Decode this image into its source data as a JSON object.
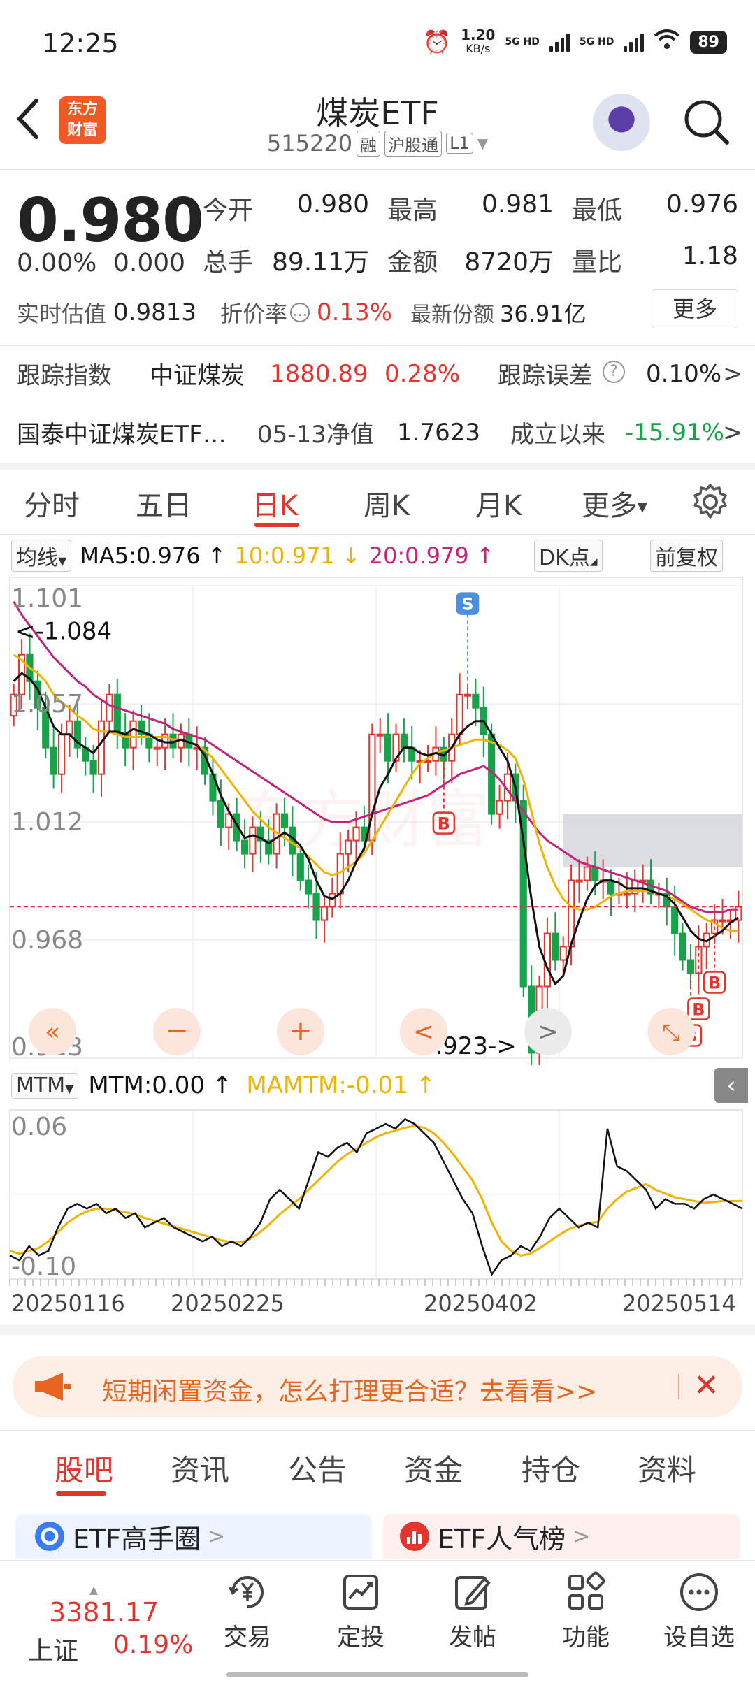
{
  "status": {
    "time": "12:25",
    "net_speed": "1.20",
    "net_unit": "KB/s",
    "sim1": "5G HD",
    "sim2": "5G HD",
    "battery": "89"
  },
  "header": {
    "logo_line1": "东方",
    "logo_line2": "财富",
    "title": "煤炭ETF",
    "code": "515220",
    "tag1": "融",
    "tag2": "沪股通",
    "tag3": "L1"
  },
  "quote": {
    "price": "0.980",
    "change_pct": "0.00%",
    "change_abs": "0.000",
    "open_label": "今开",
    "open": "0.980",
    "high_label": "最高",
    "high": "0.981",
    "low_label": "最低",
    "low": "0.976",
    "volume_label": "总手",
    "volume": "89.11万",
    "amount_label": "金额",
    "amount": "8720万",
    "ratio_label": "量比",
    "ratio": "1.18",
    "est_label": "实时估值",
    "est": "0.9813",
    "premium_label": "折价率",
    "premium": "0.13%",
    "shares_label": "最新份额",
    "shares": "36.91亿",
    "more_label": "更多"
  },
  "tracking": {
    "label": "跟踪指数",
    "index_name": "中证煤炭",
    "index_value": "1880.89",
    "index_change": "0.28%",
    "error_label": "跟踪误差",
    "error_value": "0.10%"
  },
  "fund": {
    "name": "国泰中证煤炭ETF…",
    "nav_label": "05-13净值",
    "nav_value": "1.7623",
    "since_label": "成立以来",
    "since_value": "-15.91%"
  },
  "chart_tabs": [
    "分时",
    "五日",
    "日K",
    "周K",
    "月K",
    "更多"
  ],
  "ma_bar": {
    "selector": "均线",
    "ma5": "MA5:0.976 ↑",
    "ma10": "10:0.971 ↓",
    "ma20": "20:0.979 ↑",
    "dk": "DK点",
    "adjust": "前复权"
  },
  "mtm_bar": {
    "selector": "MTM",
    "mtm": "MTM:0.00 ↑",
    "mamtm": "MAMTM:-0.01 ↑"
  },
  "colors": {
    "up": "#e5332e",
    "down": "#17a34a",
    "ma5": "#111111",
    "ma10": "#f0b400",
    "ma20": "#c5247a"
  },
  "chart_data": [
    {
      "type": "candlestick",
      "title": "",
      "y_axis_labels": [
        "1.101",
        "1.057",
        "1.012",
        "0.968",
        "0.923"
      ],
      "ylim": [
        0.923,
        1.101
      ],
      "max_annotation": "<-1.084",
      "min_annotation": "0.923->",
      "signal_labels": [
        "S",
        "B",
        "B",
        "B",
        "B"
      ],
      "candles_close": [
        1.06,
        1.075,
        1.065,
        1.055,
        1.04,
        1.03,
        1.045,
        1.05,
        1.04,
        1.035,
        1.03,
        1.05,
        1.06,
        1.045,
        1.04,
        1.05,
        1.045,
        1.04,
        1.04,
        1.045,
        1.04,
        1.045,
        1.04,
        1.04,
        1.03,
        1.02,
        1.01,
        1.015,
        1.005,
        1.0,
        1.01,
        1.005,
        1.0,
        1.015,
        1.01,
        1.0,
        0.99,
        0.985,
        0.975,
        0.98,
        0.985,
        1.0,
        1.005,
        1.01,
        1.005,
        1.045,
        1.045,
        1.035,
        1.045,
        1.04,
        1.035,
        1.035,
        1.035,
        1.04,
        1.035,
        1.045,
        1.06,
        1.06,
        1.055,
        1.045,
        1.015,
        1.02,
        1.03,
        1.02,
        0.95,
        0.925,
        0.95,
        0.97,
        0.96,
        0.965,
        0.99,
        0.99,
        0.995,
        0.99,
        0.99,
        0.985,
        0.985,
        0.985,
        0.99,
        0.99,
        0.985,
        0.985,
        0.98,
        0.97,
        0.96,
        0.955,
        0.965,
        0.97,
        0.975,
        0.975,
        0.975,
        0.98
      ],
      "ma5": [
        1.065,
        1.068,
        1.066,
        1.062,
        1.055,
        1.048,
        1.045,
        1.045,
        1.042,
        1.04,
        1.038,
        1.042,
        1.046,
        1.046,
        1.045,
        1.047,
        1.046,
        1.045,
        1.043,
        1.042,
        1.042,
        1.043,
        1.042,
        1.041,
        1.037,
        1.03,
        1.022,
        1.016,
        1.011,
        1.006,
        1.007,
        1.006,
        1.004,
        1.006,
        1.008,
        1.006,
        1.003,
        0.998,
        0.99,
        0.984,
        0.983,
        0.985,
        0.99,
        0.997,
        1.002,
        1.015,
        1.025,
        1.03,
        1.036,
        1.04,
        1.04,
        1.038,
        1.037,
        1.038,
        1.037,
        1.04,
        1.045,
        1.048,
        1.05,
        1.05,
        1.045,
        1.04,
        1.035,
        1.025,
        1.005,
        0.983,
        0.965,
        0.957,
        0.951,
        0.954,
        0.966,
        0.975,
        0.983,
        0.988,
        0.99,
        0.99,
        0.989,
        0.987,
        0.987,
        0.987,
        0.986,
        0.985,
        0.984,
        0.981,
        0.976,
        0.971,
        0.968,
        0.967,
        0.969,
        0.971,
        0.974,
        0.976
      ],
      "ma10": [
        1.075,
        1.073,
        1.07,
        1.068,
        1.065,
        1.06,
        1.057,
        1.055,
        1.052,
        1.05,
        1.047,
        1.046,
        1.046,
        1.045,
        1.044,
        1.044,
        1.044,
        1.044,
        1.044,
        1.044,
        1.043,
        1.043,
        1.042,
        1.041,
        1.039,
        1.036,
        1.032,
        1.028,
        1.024,
        1.02,
        1.016,
        1.013,
        1.01,
        1.008,
        1.006,
        1.004,
        1.002,
        0.999,
        0.996,
        0.993,
        0.992,
        0.993,
        0.995,
        0.997,
        1.0,
        1.005,
        1.01,
        1.015,
        1.02,
        1.025,
        1.03,
        1.034,
        1.036,
        1.038,
        1.039,
        1.04,
        1.041,
        1.042,
        1.043,
        1.043,
        1.042,
        1.041,
        1.039,
        1.036,
        1.028,
        1.016,
        1.004,
        0.995,
        0.988,
        0.983,
        0.98,
        0.979,
        0.979,
        0.98,
        0.982,
        0.984,
        0.985,
        0.986,
        0.986,
        0.986,
        0.986,
        0.985,
        0.984,
        0.983,
        0.981,
        0.979,
        0.977,
        0.975,
        0.974,
        0.972,
        0.971,
        0.971
      ],
      "ma20": [
        1.095,
        1.09,
        1.086,
        1.082,
        1.078,
        1.074,
        1.071,
        1.068,
        1.065,
        1.063,
        1.06,
        1.058,
        1.056,
        1.055,
        1.054,
        1.053,
        1.052,
        1.051,
        1.05,
        1.049,
        1.047,
        1.046,
        1.045,
        1.044,
        1.043,
        1.041,
        1.039,
        1.037,
        1.035,
        1.033,
        1.031,
        1.029,
        1.027,
        1.025,
        1.023,
        1.021,
        1.019,
        1.017,
        1.015,
        1.013,
        1.012,
        1.012,
        1.012,
        1.013,
        1.014,
        1.015,
        1.016,
        1.017,
        1.018,
        1.019,
        1.02,
        1.021,
        1.022,
        1.024,
        1.026,
        1.028,
        1.03,
        1.031,
        1.032,
        1.033,
        1.031,
        1.028,
        1.024,
        1.02,
        1.016,
        1.012,
        1.008,
        1.005,
        1.003,
        1.001,
        0.999,
        0.997,
        0.996,
        0.995,
        0.994,
        0.993,
        0.992,
        0.991,
        0.99,
        0.989,
        0.988,
        0.987,
        0.986,
        0.984,
        0.982,
        0.98,
        0.979,
        0.978,
        0.978,
        0.978,
        0.979,
        0.979
      ]
    },
    {
      "type": "line",
      "title": "",
      "y_axis_labels": [
        "0.06",
        "-0.10"
      ],
      "ylim": [
        -0.105,
        0.075
      ],
      "x_axis_labels": [
        "20250116",
        "20250225",
        "20250402",
        "20250514"
      ],
      "mtm": [
        -0.08,
        -0.085,
        -0.07,
        -0.08,
        -0.075,
        -0.05,
        -0.03,
        -0.025,
        -0.03,
        -0.025,
        -0.035,
        -0.03,
        -0.04,
        -0.035,
        -0.05,
        -0.045,
        -0.04,
        -0.05,
        -0.055,
        -0.06,
        -0.065,
        -0.06,
        -0.07,
        -0.065,
        -0.07,
        -0.06,
        -0.045,
        -0.02,
        -0.01,
        -0.02,
        -0.03,
        0.0,
        0.03,
        0.025,
        0.035,
        0.04,
        0.03,
        0.05,
        0.055,
        0.06,
        0.055,
        0.065,
        0.06,
        0.05,
        0.04,
        0.02,
        0.0,
        -0.02,
        -0.035,
        -0.07,
        -0.1,
        -0.085,
        -0.08,
        -0.07,
        -0.075,
        -0.06,
        -0.04,
        -0.03,
        -0.04,
        -0.05,
        -0.045,
        -0.05,
        0.055,
        0.015,
        0.01,
        0.0,
        -0.01,
        -0.03,
        -0.02,
        -0.025,
        -0.025,
        -0.03,
        -0.02,
        -0.015,
        -0.02,
        -0.025,
        -0.03
      ],
      "mamtm": [
        -0.075,
        -0.078,
        -0.075,
        -0.072,
        -0.065,
        -0.055,
        -0.045,
        -0.038,
        -0.033,
        -0.03,
        -0.03,
        -0.032,
        -0.034,
        -0.036,
        -0.04,
        -0.043,
        -0.046,
        -0.049,
        -0.052,
        -0.055,
        -0.058,
        -0.061,
        -0.064,
        -0.066,
        -0.066,
        -0.062,
        -0.055,
        -0.046,
        -0.036,
        -0.028,
        -0.02,
        -0.01,
        0.0,
        0.01,
        0.02,
        0.028,
        0.034,
        0.04,
        0.046,
        0.05,
        0.053,
        0.056,
        0.058,
        0.056,
        0.05,
        0.04,
        0.028,
        0.014,
        0.0,
        -0.02,
        -0.045,
        -0.065,
        -0.075,
        -0.08,
        -0.078,
        -0.072,
        -0.065,
        -0.058,
        -0.052,
        -0.048,
        -0.046,
        -0.044,
        -0.03,
        -0.02,
        -0.012,
        -0.008,
        -0.004,
        -0.01,
        -0.014,
        -0.018,
        -0.02,
        -0.022,
        -0.024,
        -0.023,
        -0.022,
        -0.022,
        -0.022
      ]
    }
  ],
  "ad": {
    "text": "短期闲置资金，怎么打理更合适？去看看>>"
  },
  "sub_tabs": [
    "股吧",
    "资讯",
    "公告",
    "资金",
    "持仓",
    "资料"
  ],
  "cards": {
    "card1": "ETF高手圈",
    "card2": "ETF人气榜"
  },
  "bottom_nav": {
    "index_value": "3381.17",
    "index_name": "上证",
    "index_change": "0.19%",
    "trade": "交易",
    "plan": "定投",
    "post": "发帖",
    "function": "功能",
    "watchlist": "设自选"
  }
}
